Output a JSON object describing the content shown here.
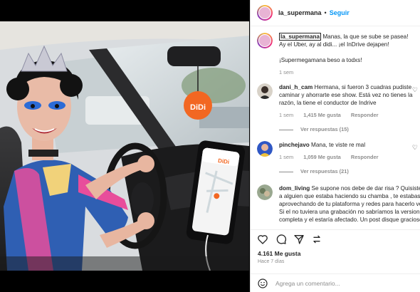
{
  "post": {
    "username": "la_supermana",
    "separator": "•",
    "follow_label": "Seguir"
  },
  "photo": {
    "sign_text": "DiDi",
    "phone_brand": "DiDi"
  },
  "caption": {
    "username": "la_supermana",
    "text_1": " Manas, la que se sube se pasea!",
    "text_2": "Ay el Uber, ay al didi... ¡el InDrive dejapen!",
    "text_3": "¡Supermegamana beso a todxs!",
    "time": "1 sem"
  },
  "comments": [
    {
      "username": "dani_h_cam",
      "text": " Hermana, si fueron 3 cuadras pudiste caminar y ahorrarte ese show. Está vez no tienes la razón, la tiene el conductor de Indrive",
      "time": "1 sem",
      "likes": "1,415 Me gusta",
      "reply": "Responder",
      "view_replies": "Ver respuestas (15)"
    },
    {
      "username": "pinchejavo",
      "text": " Mana, te viste re mal",
      "time": "1 sem",
      "likes": "1,059 Me gusta",
      "reply": "Responder",
      "view_replies": "Ver respuestas (21)"
    },
    {
      "username": "dom_living",
      "text": " Se supone nos debe de dar risa ? Quisiste afectar a alguien que estaba haciendo su chamba , te estabas aprovechando de tu plataforma y redes para hacerlo ver mal. Si el no tuviera una grabación no sabríamos la version completa y el estaría afectado. Un post disque gracioso"
    }
  ],
  "footer": {
    "likes": "4.161 Me gusta",
    "time_ago": "Hace 7 días",
    "add_comment_placeholder": "Agrega un comentario..."
  },
  "icons": {
    "like": "heart-icon",
    "comment": "comment-icon",
    "share": "share-icon",
    "save": "bookmark-icon",
    "emoji": "emoji-icon"
  },
  "colors": {
    "accent": "#0095f6",
    "didi_orange": "#f26722",
    "text": "#262626",
    "muted": "#8e8e8e"
  }
}
